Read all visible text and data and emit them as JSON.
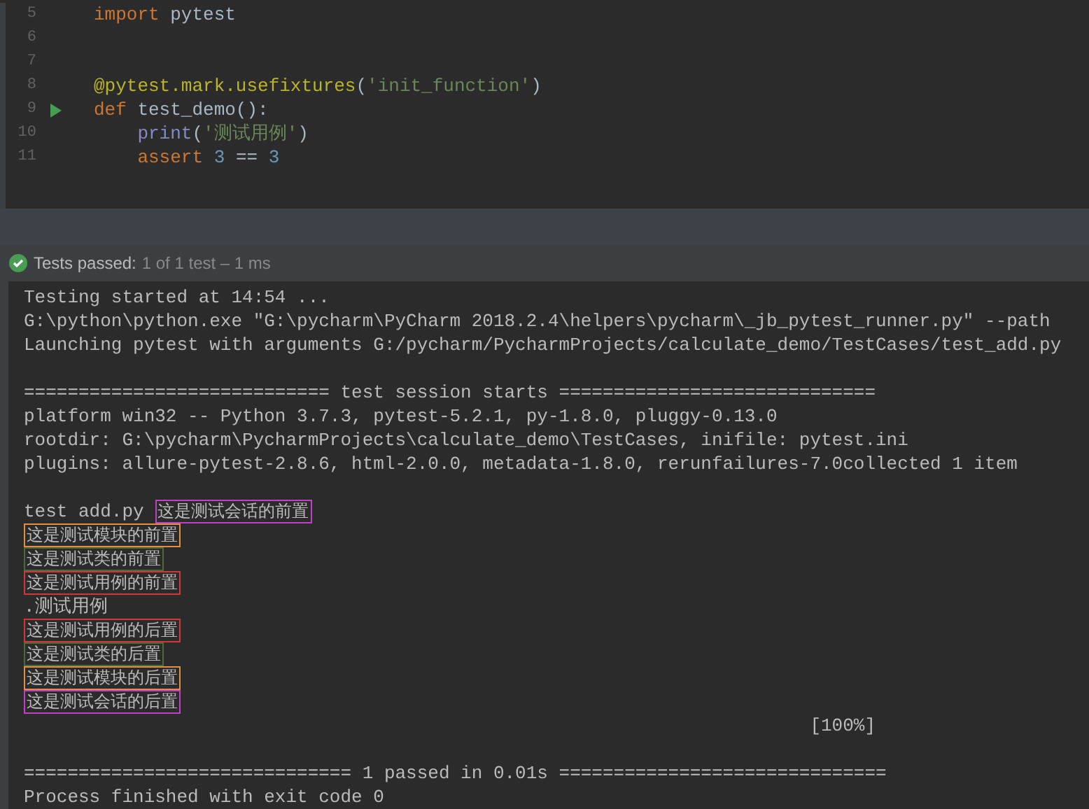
{
  "editor": {
    "lines": [
      {
        "number": "5",
        "run": false,
        "tokens": [
          {
            "kind": "keyword",
            "text": "import"
          },
          {
            "kind": "plain",
            "text": " pytest"
          }
        ]
      },
      {
        "number": "6",
        "run": false
      },
      {
        "number": "7",
        "run": false
      },
      {
        "number": "8",
        "run": false,
        "tokens": [
          {
            "kind": "decorator",
            "text": "@pytest.mark.usefixtures"
          },
          {
            "kind": "plain",
            "text": "("
          },
          {
            "kind": "string",
            "text": "'init_function'"
          },
          {
            "kind": "plain",
            "text": ")"
          }
        ]
      },
      {
        "number": "9",
        "run": true,
        "tokens": [
          {
            "kind": "keyword",
            "text": "def"
          },
          {
            "kind": "plain",
            "text": " test_demo():"
          }
        ]
      },
      {
        "number": "10",
        "run": false,
        "tokens": [
          {
            "kind": "builtin",
            "text": "    print"
          },
          {
            "kind": "plain",
            "text": "("
          },
          {
            "kind": "string",
            "text": "'测试用例'"
          },
          {
            "kind": "plain",
            "text": ")"
          }
        ]
      },
      {
        "number": "11",
        "run": false,
        "tokens": [
          {
            "kind": "keyword",
            "text": "    assert "
          },
          {
            "kind": "number",
            "text": "3"
          },
          {
            "kind": "plain",
            "text": " == "
          },
          {
            "kind": "number",
            "text": "3"
          }
        ]
      }
    ]
  },
  "status": {
    "label": "Tests passed:",
    "detail": "1 of 1 test – 1 ms"
  },
  "console": [
    {
      "kind": "text",
      "segments": [
        {
          "text": "Testing started at 14:54 ..."
        }
      ]
    },
    {
      "kind": "text",
      "segments": [
        {
          "text": "G:\\python\\python.exe \"G:\\pycharm\\PyCharm 2018.2.4\\helpers\\pycharm\\_jb_pytest_runner.py\" --path"
        }
      ]
    },
    {
      "kind": "text",
      "segments": [
        {
          "text": "Launching pytest with arguments G:/pycharm/PycharmProjects/calculate_demo/TestCases/test_add.py"
        }
      ]
    },
    {
      "kind": "blank"
    },
    {
      "kind": "text",
      "segments": [
        {
          "text": "============================ test session starts ============================="
        }
      ]
    },
    {
      "kind": "text",
      "segments": [
        {
          "text": "platform win32 -- Python 3.7.3, pytest-5.2.1, py-1.8.0, pluggy-0.13.0"
        }
      ]
    },
    {
      "kind": "text",
      "segments": [
        {
          "text": "rootdir: G:\\pycharm\\PycharmProjects\\calculate_demo\\TestCases, inifile: pytest.ini"
        }
      ]
    },
    {
      "kind": "text",
      "segments": [
        {
          "text": "plugins: allure-pytest-2.8.6, html-2.0.0, metadata-1.8.0, rerunfailures-7.0collected 1 item"
        }
      ]
    },
    {
      "kind": "blank"
    },
    {
      "kind": "text",
      "segments": [
        {
          "text": "test add.py "
        },
        {
          "text": "这是测试会话的前置",
          "color": "#c040c8"
        }
      ]
    },
    {
      "kind": "text",
      "segments": [
        {
          "text": "这是测试模块的前置",
          "color": "#e09040"
        }
      ]
    },
    {
      "kind": "text",
      "segments": [
        {
          "text": "这是测试类的前置",
          "color": "#4a6a3a"
        }
      ]
    },
    {
      "kind": "text",
      "segments": [
        {
          "text": "这是测试用例的前置",
          "color": "#d03838"
        }
      ]
    },
    {
      "kind": "text",
      "segments": [
        {
          "text": ".测试用例"
        }
      ]
    },
    {
      "kind": "text",
      "segments": [
        {
          "text": "这是测试用例的后置",
          "color": "#d03838"
        }
      ]
    },
    {
      "kind": "text",
      "segments": [
        {
          "text": "这是测试类的后置",
          "color": "#4a6a3a"
        }
      ]
    },
    {
      "kind": "text",
      "segments": [
        {
          "text": "这是测试模块的后置",
          "color": "#e09040"
        }
      ]
    },
    {
      "kind": "text",
      "segments": [
        {
          "text": "这是测试会话的后置",
          "color": "#c040c8"
        }
      ]
    },
    {
      "kind": "text",
      "segments": [
        {
          "text": "                                                                        [100%]"
        }
      ]
    },
    {
      "kind": "blank"
    },
    {
      "kind": "text",
      "segments": [
        {
          "text": "============================== 1 passed in 0.01s =============================="
        }
      ]
    },
    {
      "kind": "text",
      "segments": [
        {
          "text": "Process finished with exit code 0"
        }
      ]
    }
  ]
}
